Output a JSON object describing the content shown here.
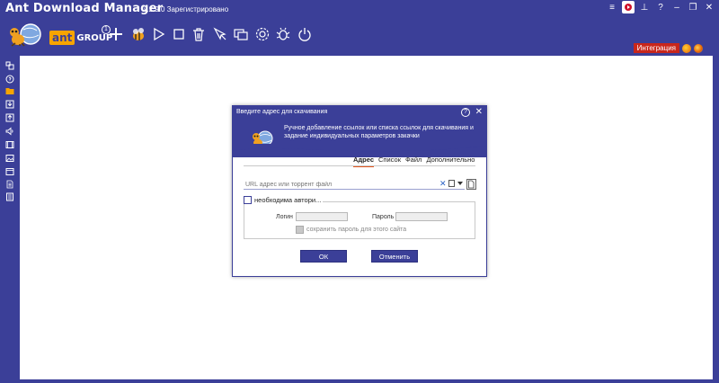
{
  "app": {
    "title": "Ant Download Manager",
    "version_text": "v.2.9.0  Зарегистрировано"
  },
  "window_controls": [
    {
      "name": "menu-icon",
      "glyph": "≡"
    },
    {
      "name": "record-icon",
      "glyph": ""
    },
    {
      "name": "pin-icon",
      "glyph": "⊥"
    },
    {
      "name": "help-icon",
      "glyph": "?"
    },
    {
      "name": "minimize-icon",
      "glyph": "–"
    },
    {
      "name": "restore-icon",
      "glyph": "❐"
    },
    {
      "name": "close-icon",
      "glyph": "✕"
    }
  ],
  "toolbar": {
    "brand_ant": "ant",
    "brand_group": "GROUP",
    "brand_badge": "1",
    "buttons": [
      "bee-icon",
      "play-icon",
      "stop-icon",
      "trash-icon",
      "link-cursor-icon",
      "windows-icon",
      "gear-icon",
      "bug-icon",
      "power-icon"
    ]
  },
  "integration": {
    "label": "Интеграция",
    "browser_colors": [
      "#e66000",
      "#4a90e2"
    ]
  },
  "sidebar": {
    "items": [
      "all-downloads-icon",
      "question-icon",
      "folder-icon",
      "download-in-icon",
      "download-out-icon",
      "audio-icon",
      "video-icon",
      "image-icon",
      "archive-icon",
      "document-icon",
      "other-icon"
    ]
  },
  "dialog": {
    "title": "Введите адрес для скачивания",
    "help": "?",
    "close": "✕",
    "description": "Ручное добавление ссылок или списка ссылок для скачивания и задание индивидуальных параметров закачки",
    "tabs": [
      "Адрес",
      "Список",
      "Файл",
      "Дополнительно"
    ],
    "active_tab": "Адрес",
    "url_placeholder": "URL адрес или торрент файл",
    "auth_label": "необходима автори...",
    "login_label": "Логин",
    "password_label": "Пароль",
    "save_password_label": "сохранить пароль для этого сайта",
    "ok_label": "ОК",
    "cancel_label": "Отменить"
  },
  "colors": {
    "primary": "#3b3f98",
    "accent": "#e2561d",
    "integration_red": "#c8261b"
  }
}
